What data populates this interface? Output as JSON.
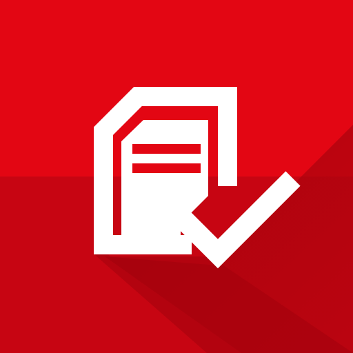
{
  "icon": {
    "name": "document-check-icon",
    "colors": {
      "background_light": "#e30613",
      "background_band": "#c70512",
      "long_shadow": "#a3020c",
      "glyph": "#ffffff"
    }
  }
}
